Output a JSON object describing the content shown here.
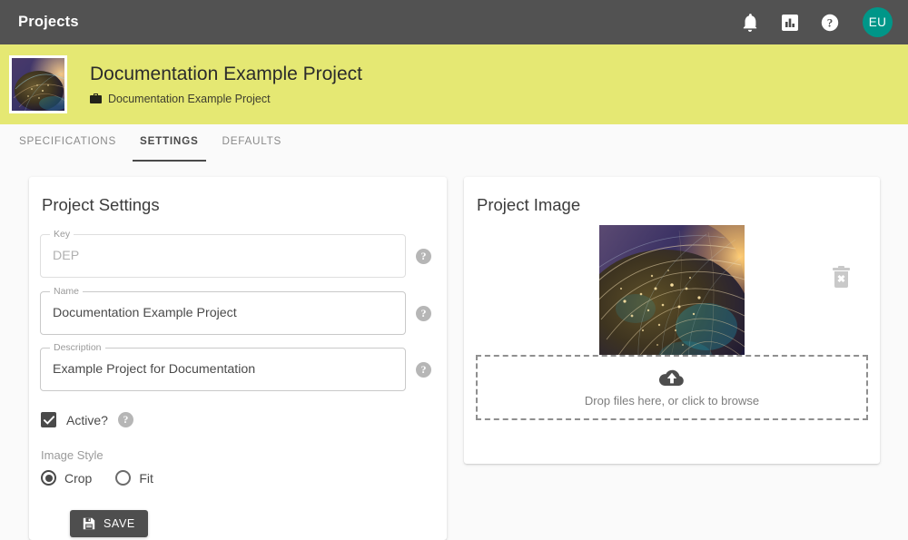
{
  "appbar": {
    "title": "Projects",
    "icons": [
      {
        "name": "notifications-bell-icon",
        "glyph": "bell"
      },
      {
        "name": "reports-chart-icon",
        "glyph": "bar-chart"
      },
      {
        "name": "help-circle-icon",
        "glyph": "question"
      }
    ],
    "avatar": {
      "initials": "EU",
      "color": "#009688"
    },
    "background": "#525252"
  },
  "banner": {
    "title": "Documentation Example Project",
    "subtitle": "Documentation Example Project",
    "icon": "briefcase-icon",
    "background": "#e5e873",
    "thumbnail_alt": "project-thumbnail"
  },
  "tabs": [
    {
      "label": "SPECIFICATIONS",
      "active": false
    },
    {
      "label": "SETTINGS",
      "active": true
    },
    {
      "label": "DEFAULTS",
      "active": false
    }
  ],
  "settings_card": {
    "title": "Project Settings",
    "fields": [
      {
        "label": "Key",
        "value": "DEP",
        "disabled": true,
        "help": "?"
      },
      {
        "label": "Name",
        "value": "Documentation Example Project",
        "disabled": false,
        "help": "?"
      },
      {
        "label": "Description",
        "value": "Example Project for Documentation",
        "disabled": false,
        "help": "?"
      }
    ],
    "active_checkbox": {
      "label": "Active?",
      "checked": true,
      "help": "?"
    },
    "image_style": {
      "label": "Image Style",
      "options": [
        {
          "label": "Crop",
          "selected": true
        },
        {
          "label": "Fit",
          "selected": false
        }
      ]
    },
    "save_button": {
      "label": "SAVE",
      "icon": "save-disk-icon"
    }
  },
  "image_card": {
    "title": "Project Image",
    "delete_icon": "delete-trash-icon",
    "dropzone": {
      "text": "Drop files here, or click to browse",
      "icon": "cloud-upload-icon"
    }
  }
}
